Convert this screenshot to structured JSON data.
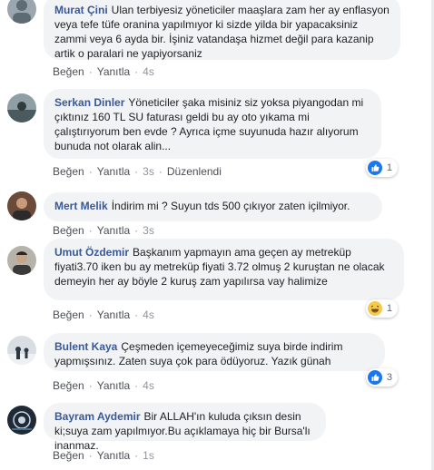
{
  "comments": [
    {
      "author": "Murat Çini",
      "text": "Ulan terbiyesiz yöneticiler maaşlara zam her ay enflasyon veya tefe tüfe oranina yapılmıyor ki sizde yilda bir yapacaksiniz zammi veya 6 ayda bir. İşiniz vatandaşa hizmet değil para kazanip artik o paralari ne yapiyorsaniz",
      "like_label": "Beğen",
      "reply_label": "Yanıtla",
      "time": "4s",
      "edited_label": "",
      "reaction_count": ""
    },
    {
      "author": "Serkan Dinler",
      "text": "Yöneticiler şaka misiniz siz yoksa piyangodan mi çıktınız 160 TL SU faturası geldi bu ay oto yıkama mi çalıştırıyorum ben evde ? Ayrıca içme suyunuda hazır alıyorum bunuda not olarak alin...",
      "like_label": "Beğen",
      "reply_label": "Yanıtla",
      "time": "3s",
      "edited_label": "Düzenlendi",
      "reaction_count": "1",
      "reaction_icon": "like-icon"
    },
    {
      "author": "Mert Melik",
      "text": "İndirim mi ? Suyun tds 500 çıkıyor zaten içilmiyor.",
      "like_label": "Beğen",
      "reply_label": "Yanıtla",
      "time": "3s",
      "edited_label": "",
      "reaction_count": ""
    },
    {
      "author": "Umut Özdemir",
      "text": "Başkanım yapmayın ama geçen ay metreküp fiyati3.70 iken bu ay metreküp fiyati 3.72 olmuş 2 kuruştan ne olacak demeyin her ay böyle 2 kuruş zam yapılırsa vay halimize",
      "like_label": "Beğen",
      "reply_label": "Yanıtla",
      "time": "4s",
      "edited_label": "",
      "reaction_count": "1",
      "reaction_icon": "haha-icon"
    },
    {
      "author": "Bulent Kaya",
      "text": "Çeşmeden içemeyeceğimiz suya birde indirim yapmışsınız. Zaten suya çok para ödüyoruz. Yazık günah",
      "like_label": "Beğen",
      "reply_label": "Yanıtla",
      "time": "4s",
      "edited_label": "",
      "reaction_count": "3",
      "reaction_icon": "like-icon"
    },
    {
      "author": "Bayram Aydemir",
      "text": "Bir ALLAH'ın kuluda çıksın desin ki;suya zam yapılmıyor.Bu açıklamaya hiç bir Bursa'lı inanmaz.",
      "like_label": "Beğen",
      "reply_label": "Yanıtla",
      "time": "1s",
      "edited_label": "",
      "reaction_count": ""
    }
  ],
  "colors": {
    "author": "#385898",
    "bubble": "#f2f3f5",
    "like_blue": "#1877f2",
    "haha_yellow": "#f7c94a"
  }
}
